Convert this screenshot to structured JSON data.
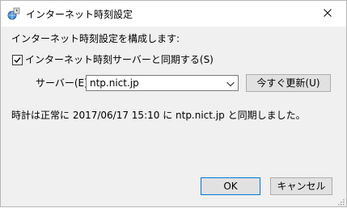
{
  "window": {
    "title": "インターネット時刻設定"
  },
  "content": {
    "intro": "インターネット時刻設定を構成します:",
    "sync_checkbox_label": "インターネット時刻サーバーと同期する(S)",
    "sync_checked": true,
    "server_label": "サーバー(E):",
    "server_value": "ntp.nict.jp",
    "update_now_label": "今すぐ更新(U)",
    "status": "時計は正常に 2017/06/17 15:10 に ntp.nict.jp と同期しました。"
  },
  "buttons": {
    "ok_label": "OK",
    "cancel_label": "キャンセル"
  },
  "colors": {
    "title_bg": "#ffffff",
    "client_bg": "#f0f0f0",
    "button_bg": "#e1e1e1",
    "default_border": "#0078d7"
  },
  "icons": {
    "title": "globe-clock-icon",
    "close": "close-icon",
    "dropdown": "chevron-down-icon",
    "checkbox": "checkmark-icon"
  }
}
